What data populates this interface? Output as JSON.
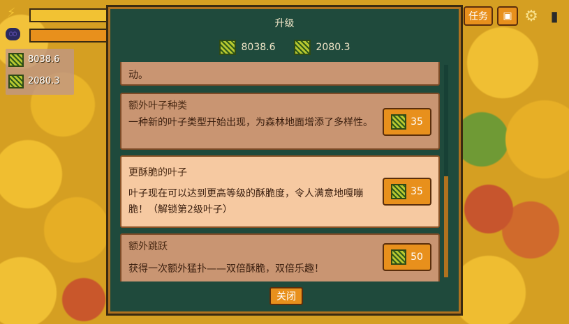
{
  "hud": {
    "energy_icon": "lightning-icon",
    "energy_level": 0.9,
    "infinity_icon": "infinity-icon",
    "resource1": "8038.6",
    "resource2": "2080.3",
    "task_label": "任务",
    "chest_icon": "chest-icon",
    "settings_icon": "gear-icon",
    "exit_icon": "door-icon"
  },
  "modal": {
    "title": "升级",
    "res1": "8038.6",
    "res2": "2080.3",
    "close_label": "关闭",
    "items": [
      {
        "title": "",
        "desc": "动。",
        "cost": ""
      },
      {
        "title": "额外叶子种类",
        "desc": "一种新的叶子类型开始出现，为森林地面增添了多样性。",
        "cost": "35"
      },
      {
        "title": "更酥脆的叶子",
        "desc": "叶子现在可以达到更高等级的酥脆度，令人满意地嘎嘣脆！（解锁第2级叶子）",
        "cost": "35"
      },
      {
        "title": "额外跳跃",
        "desc": "获得一次额外猛扑——双倍酥脆，双倍乐趣！",
        "cost": "50"
      }
    ]
  },
  "colors": {
    "modal_bg": "#1f4a3c",
    "card_bg": "#c99572",
    "card_highlight": "#f6c9a1",
    "button": "#e8901c",
    "energy_fill": "#f2c233",
    "mana_fill": "#e8901c"
  }
}
